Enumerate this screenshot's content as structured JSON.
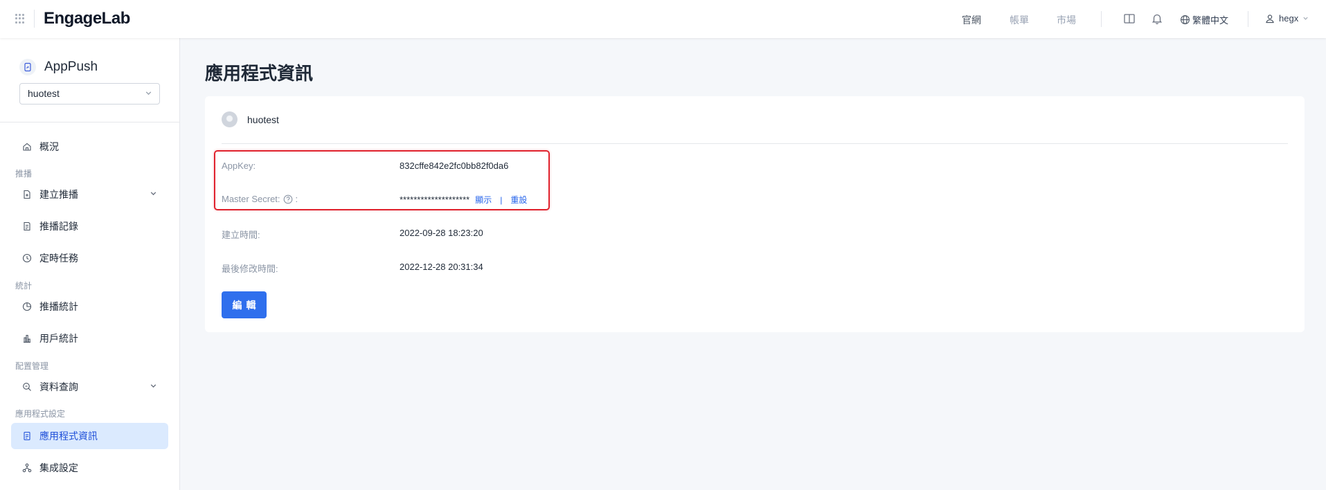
{
  "topbar": {
    "logo": "EngageLab",
    "nav": [
      "官網",
      "帳單",
      "市場"
    ],
    "language": "繁體中文",
    "user": "hegx",
    "icons": [
      "apps-grid-icon",
      "book-icon",
      "bell-icon",
      "globe-icon",
      "user-icon"
    ]
  },
  "sidebar": {
    "app_title": "AppPush",
    "app_select": "huotest",
    "items": [
      {
        "label": "概況",
        "icon": "home-icon"
      },
      {
        "label": "推播",
        "group": true
      },
      {
        "label": "建立推播",
        "icon": "doc-add-icon",
        "expandable": true
      },
      {
        "label": "推播記錄",
        "icon": "list-doc-icon"
      },
      {
        "label": "定時任務",
        "icon": "clock-icon"
      },
      {
        "label": "統計",
        "group": true
      },
      {
        "label": "推播統計",
        "icon": "pie-icon"
      },
      {
        "label": "用戶統計",
        "icon": "bar-icon"
      },
      {
        "label": "配置管理",
        "group": true
      },
      {
        "label": "資料查詢",
        "icon": "search-doc-icon",
        "expandable": true
      },
      {
        "label": "應用程式設定",
        "group": true
      },
      {
        "label": "應用程式資訊",
        "icon": "info-doc-icon",
        "active": true
      },
      {
        "label": "集成設定",
        "icon": "network-icon"
      }
    ]
  },
  "main": {
    "title": "應用程式資訊",
    "app_name": "huotest",
    "fields": {
      "appkey_label": "AppKey:",
      "appkey_value": "832cffe842e2fc0bb82f0da6",
      "secret_label": "Master Secret:",
      "secret_colon": ":",
      "secret_value": "********************",
      "show_link": "顯示",
      "link_sep": "|",
      "reset_link": "重設",
      "created_label": "建立時間:",
      "created_value": "2022-09-28 18:23:20",
      "modified_label": "最後修改時間:",
      "modified_value": "2022-12-28 20:31:34"
    },
    "edit_button": "編輯"
  },
  "colors": {
    "accent": "#2f6fed",
    "active_bg": "#dbeafe",
    "highlight_border": "#e0232e"
  }
}
